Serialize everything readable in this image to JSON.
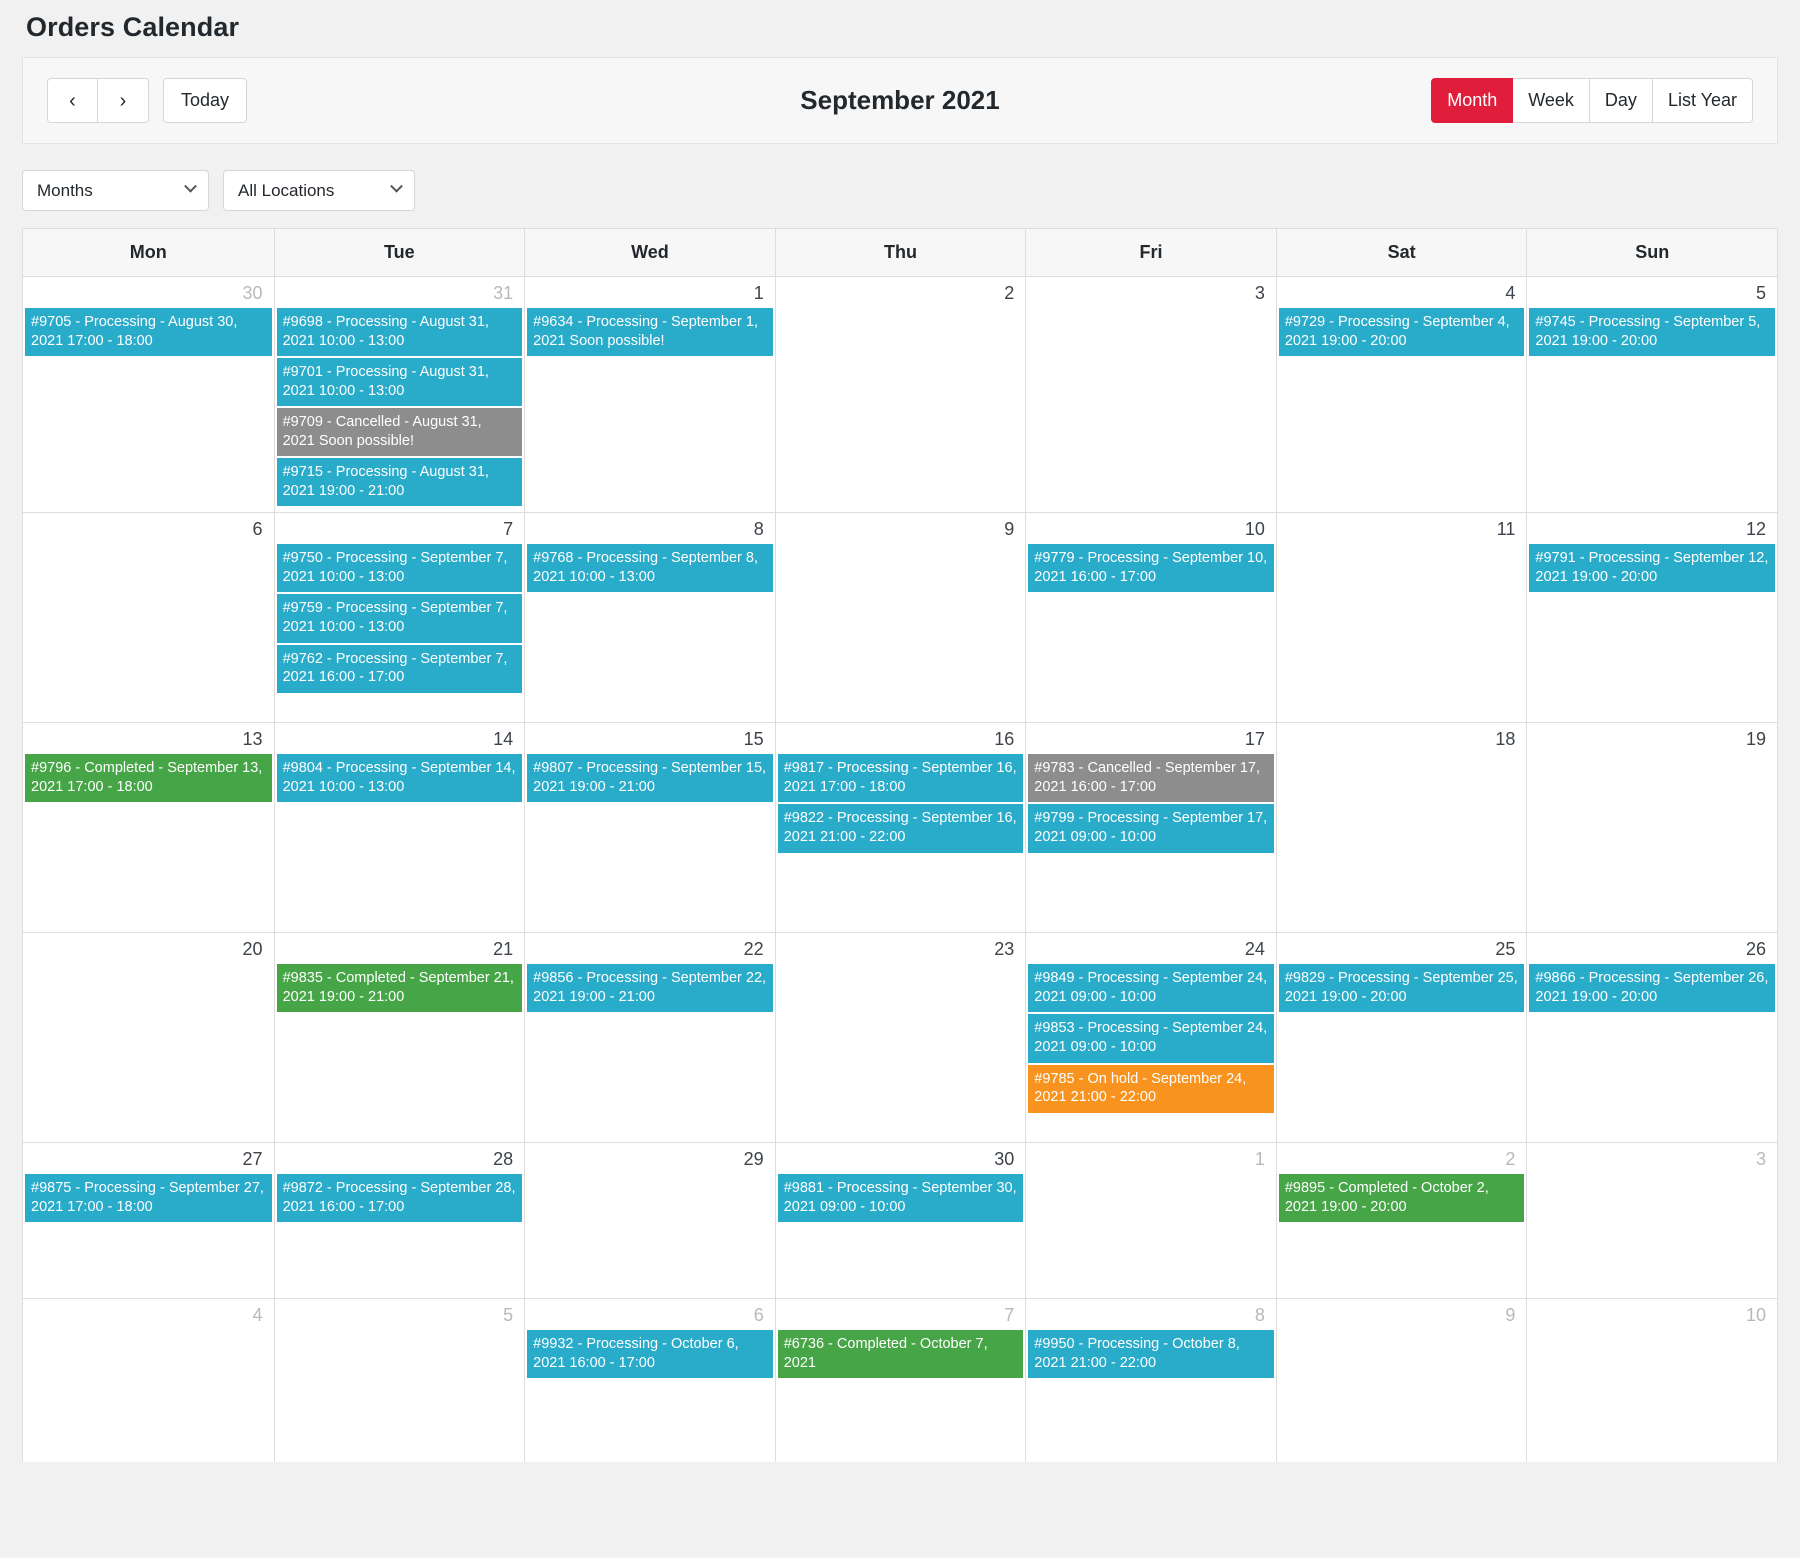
{
  "page": {
    "title": "Orders Calendar"
  },
  "toolbar": {
    "prev_icon": "chevron-left-icon",
    "next_icon": "chevron-right-icon",
    "prev_label": "‹",
    "next_label": "›",
    "today_label": "Today",
    "current_period": "September 2021",
    "views": [
      {
        "label": "Month",
        "active": true
      },
      {
        "label": "Week",
        "active": false
      },
      {
        "label": "Day",
        "active": false
      },
      {
        "label": "List Year",
        "active": false
      }
    ]
  },
  "filters": {
    "period_select": {
      "value": "Months",
      "icon": "chevron-down-icon"
    },
    "location_select": {
      "value": "All Locations",
      "icon": "chevron-down-icon"
    }
  },
  "colors": {
    "accent": "#e01e3c",
    "processing": "#29abca",
    "completed": "#46a546",
    "cancelled": "#8d8d8d",
    "onhold": "#f7931e",
    "grid": "#dddddd",
    "header_bg": "#f7f7f7"
  },
  "calendar": {
    "weekday_headers": [
      "Mon",
      "Tue",
      "Wed",
      "Thu",
      "Fri",
      "Sat",
      "Sun"
    ],
    "weeks": [
      {
        "days": [
          {
            "num": "30",
            "other_month": true,
            "events": [
              {
                "status": "processing",
                "text": "#9705 - Processing - August 30, 2021 17:00 - 18:00"
              }
            ]
          },
          {
            "num": "31",
            "other_month": true,
            "events": [
              {
                "status": "processing",
                "text": "#9698 - Processing - August 31, 2021 10:00 - 13:00"
              },
              {
                "status": "processing",
                "text": "#9701 - Processing - August 31, 2021 10:00 - 13:00"
              },
              {
                "status": "cancelled",
                "text": "#9709 - Cancelled - August 31, 2021 Soon possible!"
              },
              {
                "status": "processing",
                "text": "#9715 - Processing - August 31, 2021 19:00 - 21:00"
              }
            ]
          },
          {
            "num": "1",
            "other_month": false,
            "events": [
              {
                "status": "processing",
                "text": "#9634 - Processing - September 1, 2021 Soon possible!"
              }
            ]
          },
          {
            "num": "2",
            "other_month": false,
            "events": []
          },
          {
            "num": "3",
            "other_month": false,
            "events": []
          },
          {
            "num": "4",
            "other_month": false,
            "events": [
              {
                "status": "processing",
                "text": "#9729 - Processing - September 4, 2021 19:00 - 20:00"
              }
            ]
          },
          {
            "num": "5",
            "other_month": false,
            "events": [
              {
                "status": "processing",
                "text": "#9745 - Processing - September 5, 2021 19:00 - 20:00"
              }
            ]
          }
        ]
      },
      {
        "days": [
          {
            "num": "6",
            "other_month": false,
            "events": []
          },
          {
            "num": "7",
            "other_month": false,
            "events": [
              {
                "status": "processing",
                "text": "#9750 - Processing - September 7, 2021 10:00 - 13:00"
              },
              {
                "status": "processing",
                "text": "#9759 - Processing - September 7, 2021 10:00 - 13:00"
              },
              {
                "status": "processing",
                "text": "#9762 - Processing - September 7, 2021 16:00 - 17:00"
              }
            ]
          },
          {
            "num": "8",
            "other_month": false,
            "events": [
              {
                "status": "processing",
                "text": "#9768 - Processing - September 8, 2021 10:00 - 13:00"
              }
            ]
          },
          {
            "num": "9",
            "other_month": false,
            "events": []
          },
          {
            "num": "10",
            "other_month": false,
            "events": [
              {
                "status": "processing",
                "text": "#9779 - Processing - September 10, 2021 16:00 - 17:00"
              }
            ]
          },
          {
            "num": "11",
            "other_month": false,
            "events": []
          },
          {
            "num": "12",
            "other_month": false,
            "events": [
              {
                "status": "processing",
                "text": "#9791 - Processing - September 12, 2021 19:00 - 20:00"
              }
            ]
          }
        ]
      },
      {
        "days": [
          {
            "num": "13",
            "other_month": false,
            "events": [
              {
                "status": "completed",
                "text": "#9796 - Completed - September 13, 2021 17:00 - 18:00"
              }
            ]
          },
          {
            "num": "14",
            "other_month": false,
            "events": [
              {
                "status": "processing",
                "text": "#9804 - Processing - September 14, 2021 10:00 - 13:00"
              }
            ]
          },
          {
            "num": "15",
            "other_month": false,
            "events": [
              {
                "status": "processing",
                "text": "#9807 - Processing - September 15, 2021 19:00 - 21:00"
              }
            ]
          },
          {
            "num": "16",
            "other_month": false,
            "events": [
              {
                "status": "processing",
                "text": "#9817 - Processing - September 16, 2021 17:00 - 18:00"
              },
              {
                "status": "processing",
                "text": "#9822 - Processing - September 16, 2021 21:00 - 22:00"
              }
            ]
          },
          {
            "num": "17",
            "other_month": false,
            "events": [
              {
                "status": "cancelled",
                "text": "#9783 - Cancelled - September 17, 2021 16:00 - 17:00"
              },
              {
                "status": "processing",
                "text": "#9799 - Processing - September 17, 2021 09:00 - 10:00"
              }
            ]
          },
          {
            "num": "18",
            "other_month": false,
            "events": []
          },
          {
            "num": "19",
            "other_month": false,
            "events": []
          }
        ]
      },
      {
        "days": [
          {
            "num": "20",
            "other_month": false,
            "events": []
          },
          {
            "num": "21",
            "other_month": false,
            "events": [
              {
                "status": "completed",
                "text": "#9835 - Completed - September 21, 2021 19:00 - 21:00"
              }
            ]
          },
          {
            "num": "22",
            "other_month": false,
            "events": [
              {
                "status": "processing",
                "text": "#9856 - Processing - September 22, 2021 19:00 - 21:00"
              }
            ]
          },
          {
            "num": "23",
            "other_month": false,
            "events": []
          },
          {
            "num": "24",
            "other_month": false,
            "events": [
              {
                "status": "processing",
                "text": "#9849 - Processing - September 24, 2021 09:00 - 10:00"
              },
              {
                "status": "processing",
                "text": "#9853 - Processing - September 24, 2021 09:00 - 10:00"
              },
              {
                "status": "onhold",
                "text": "#9785 - On hold - September 24, 2021 21:00 - 22:00"
              }
            ]
          },
          {
            "num": "25",
            "other_month": false,
            "events": [
              {
                "status": "processing",
                "text": "#9829 - Processing - September 25, 2021 19:00 - 20:00"
              }
            ]
          },
          {
            "num": "26",
            "other_month": false,
            "events": [
              {
                "status": "processing",
                "text": "#9866 - Processing - September 26, 2021 19:00 - 20:00"
              }
            ]
          }
        ]
      },
      {
        "days": [
          {
            "num": "27",
            "other_month": false,
            "events": [
              {
                "status": "processing",
                "text": "#9875 - Processing - September 27, 2021 17:00 - 18:00"
              }
            ]
          },
          {
            "num": "28",
            "other_month": false,
            "events": [
              {
                "status": "processing",
                "text": "#9872 - Processing - September 28, 2021 16:00 - 17:00"
              }
            ]
          },
          {
            "num": "29",
            "other_month": false,
            "events": []
          },
          {
            "num": "30",
            "other_month": false,
            "events": [
              {
                "status": "processing",
                "text": "#9881 - Processing - September 30, 2021 09:00 - 10:00"
              }
            ]
          },
          {
            "num": "1",
            "other_month": true,
            "events": []
          },
          {
            "num": "2",
            "other_month": true,
            "events": [
              {
                "status": "completed",
                "text": "#9895 - Completed - October 2, 2021 19:00 - 20:00"
              }
            ]
          },
          {
            "num": "3",
            "other_month": true,
            "events": []
          }
        ]
      },
      {
        "days": [
          {
            "num": "4",
            "other_month": true,
            "events": []
          },
          {
            "num": "5",
            "other_month": true,
            "events": []
          },
          {
            "num": "6",
            "other_month": true,
            "events": [
              {
                "status": "processing",
                "text": "#9932 - Processing - October 6, 2021 16:00 - 17:00"
              }
            ]
          },
          {
            "num": "7",
            "other_month": true,
            "events": [
              {
                "status": "completed",
                "text": "#6736 - Completed - October 7, 2021"
              }
            ]
          },
          {
            "num": "8",
            "other_month": true,
            "events": [
              {
                "status": "processing",
                "text": "#9950 - Processing - October 8, 2021 21:00 - 22:00"
              }
            ]
          },
          {
            "num": "9",
            "other_month": true,
            "events": []
          },
          {
            "num": "10",
            "other_month": true,
            "events": []
          }
        ]
      }
    ]
  }
}
